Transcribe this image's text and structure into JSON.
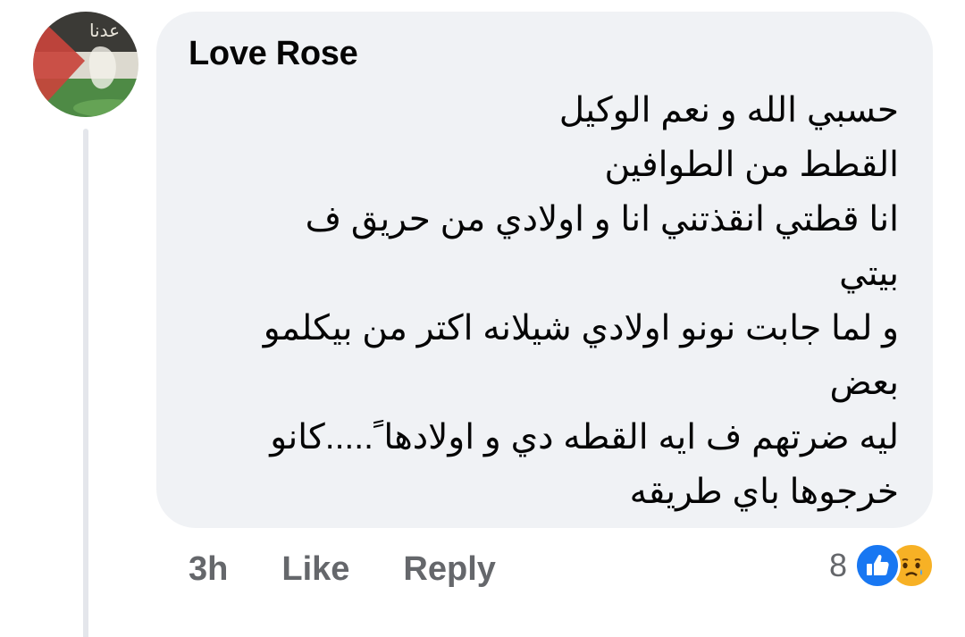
{
  "comment": {
    "author": "Love Rose",
    "avatar_text": "عدنا",
    "lines": [
      "حسبي الله و نعم الوكيل",
      "القطط من الطوافين",
      "انا قطتي انقذتني انا و اولادي من حريق ف",
      "بيتي",
      " و لما جابت نونو اولادي شيلانه اكتر من بيكلمو",
      "بعض",
      "ليه ضرتهم ف ايه القطه دي و اولادها ً.....كانو",
      "خرجوها باي طريقه"
    ]
  },
  "actions": {
    "time": "3h",
    "like_label": "Like",
    "reply_label": "Reply"
  },
  "reactions": {
    "count": "8",
    "types": [
      "like-icon",
      "sad-icon"
    ],
    "like_color": "#1877f2",
    "sad_color": "#f7b125"
  },
  "colors": {
    "bubble": "#f0f2f5",
    "text": "#050505",
    "secondary_text": "#65676b"
  }
}
